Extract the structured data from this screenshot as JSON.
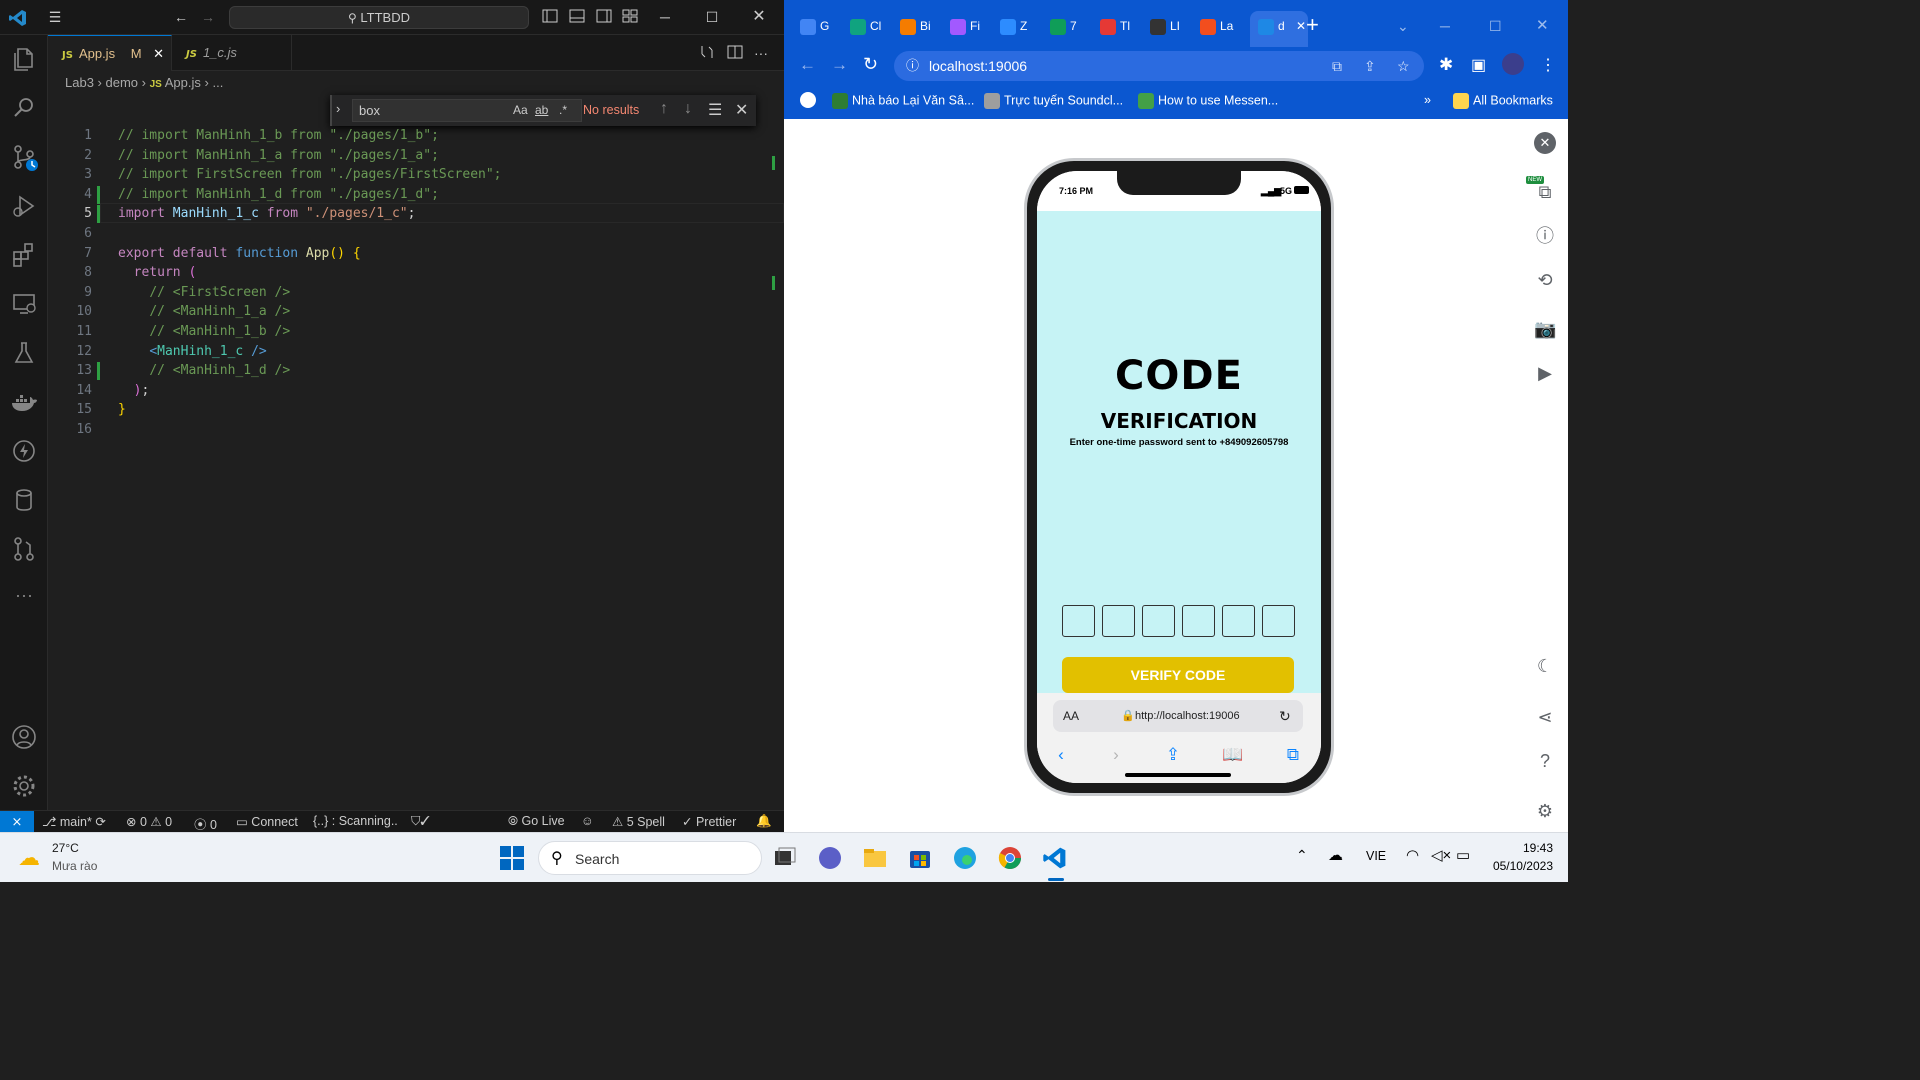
{
  "vscode": {
    "command_center": "LTTBDD",
    "tabs": [
      {
        "icon": "JS",
        "label": "App.js",
        "badge": "M",
        "active": true
      },
      {
        "icon": "JS",
        "label": "1_c.js",
        "active": false
      }
    ],
    "breadcrumb": {
      "part1": "Lab3",
      "part2": "demo",
      "file_icon": "JS",
      "file": "App.js",
      "ellipsis": "..."
    },
    "find": {
      "query": "box",
      "result": "No results",
      "match_case": "Aa",
      "whole_word": "ab",
      "regex": ".*"
    },
    "code_lines": [
      {
        "n": "1",
        "tokens": [
          [
            "cm",
            "// import ManHinh_1_b from \"./pages/1_b\";"
          ]
        ]
      },
      {
        "n": "2",
        "tokens": [
          [
            "cm",
            "// import ManHinh_1_a from \"./pages/1_a\";"
          ]
        ]
      },
      {
        "n": "3",
        "tokens": [
          [
            "cm",
            "// import FirstScreen from \"./pages/FirstScreen\";"
          ]
        ]
      },
      {
        "n": "4",
        "tokens": [
          [
            "cm",
            "// import ManHinh_1_d from \"./pages/1_d\";"
          ]
        ]
      },
      {
        "n": "5",
        "tokens": [
          [
            "kw",
            "import "
          ],
          [
            "id",
            "ManHinh_1_c"
          ],
          [
            "kw",
            " from "
          ],
          [
            "str",
            "\"./pages/1_c\""
          ],
          [
            "pl",
            ";"
          ]
        ]
      },
      {
        "n": "6",
        "tokens": []
      },
      {
        "n": "7",
        "tokens": [
          [
            "kw",
            "export "
          ],
          [
            "kw",
            "default "
          ],
          [
            "kb",
            "function "
          ],
          [
            "fn",
            "App"
          ],
          [
            "br1",
            "()"
          ],
          [
            "pl",
            " "
          ],
          [
            "br1",
            "{"
          ]
        ]
      },
      {
        "n": "8",
        "tokens": [
          [
            "pl",
            "  "
          ],
          [
            "kw",
            "return "
          ],
          [
            "br2",
            "("
          ]
        ]
      },
      {
        "n": "9",
        "tokens": [
          [
            "pl",
            "    "
          ],
          [
            "cm",
            "// <FirstScreen />"
          ]
        ]
      },
      {
        "n": "10",
        "tokens": [
          [
            "pl",
            "    "
          ],
          [
            "cm",
            "// <ManHinh_1_a />"
          ]
        ]
      },
      {
        "n": "11",
        "tokens": [
          [
            "pl",
            "    "
          ],
          [
            "cm",
            "// <ManHinh_1_b />"
          ]
        ]
      },
      {
        "n": "12",
        "tokens": [
          [
            "pl",
            "    "
          ],
          [
            "kb",
            "<"
          ],
          [
            "tg",
            "ManHinh_1_c"
          ],
          [
            "pl",
            " "
          ],
          [
            "kb",
            "/>"
          ]
        ]
      },
      {
        "n": "13",
        "tokens": [
          [
            "pl",
            "    "
          ],
          [
            "cm",
            "// <ManHinh_1_d />"
          ]
        ]
      },
      {
        "n": "14",
        "tokens": [
          [
            "pl",
            "  "
          ],
          [
            "br2",
            ")"
          ],
          [
            "pl",
            ";"
          ]
        ]
      },
      {
        "n": "15",
        "tokens": [
          [
            "br1",
            "}"
          ]
        ]
      },
      {
        "n": "16",
        "tokens": []
      }
    ],
    "status": {
      "branch": "main*",
      "errors": "0",
      "warnings": "0",
      "ports": "0",
      "connect": "Connect",
      "scanning": "{..} : Scanning..",
      "golive": "Go Live",
      "spell": "5 Spell",
      "prettier": "Prettier"
    }
  },
  "chrome": {
    "tabs": [
      {
        "label": "G",
        "color": "#4285f4"
      },
      {
        "label": "Cl",
        "color": "#10a37f"
      },
      {
        "label": "Bi",
        "color": "#f57c00"
      },
      {
        "label": "Fi",
        "color": "#a259ff"
      },
      {
        "label": "Z",
        "color": "#2d8cff"
      },
      {
        "label": "7",
        "color": "#0f9d58"
      },
      {
        "label": "Tl",
        "color": "#e53935"
      },
      {
        "label": "LI",
        "color": "#333333"
      },
      {
        "label": "La",
        "color": "#f24e1e"
      },
      {
        "label": "d",
        "color": "#1e88e5"
      }
    ],
    "new_tab": "+",
    "url": "localhost:19006",
    "bookmarks": [
      {
        "label": "Nhà báo Lại Văn Sâ...",
        "color": "#2e7d32"
      },
      {
        "label": "Trực tuyến Soundcl...",
        "color": "#9e9e9e"
      },
      {
        "label": "How to use Messen...",
        "color": "#43a047"
      }
    ],
    "bookmarks_more": "»",
    "all_bookmarks": "All Bookmarks",
    "new_badge": "NEW"
  },
  "phone": {
    "time": "7:16 PM",
    "network": "5G",
    "title": "CODE",
    "subtitle": "VERIFICATION",
    "description": "Enter one-time password sent to +849092605798",
    "otp_boxes": 6,
    "verify_label": "VERIFY CODE",
    "safari_aa": "AA",
    "safari_url": "http://localhost:19006"
  },
  "taskbar": {
    "temp": "27°C",
    "weather": "Mưa rào",
    "search_placeholder": "Search",
    "lang": "VIE",
    "time": "19:43",
    "date": "05/10/2023"
  },
  "colors": {
    "accent": "#0078d4",
    "chrome_blue": "#0b57d0",
    "app_bg": "#c6f3f5",
    "verify_btn": "#e2c000"
  }
}
